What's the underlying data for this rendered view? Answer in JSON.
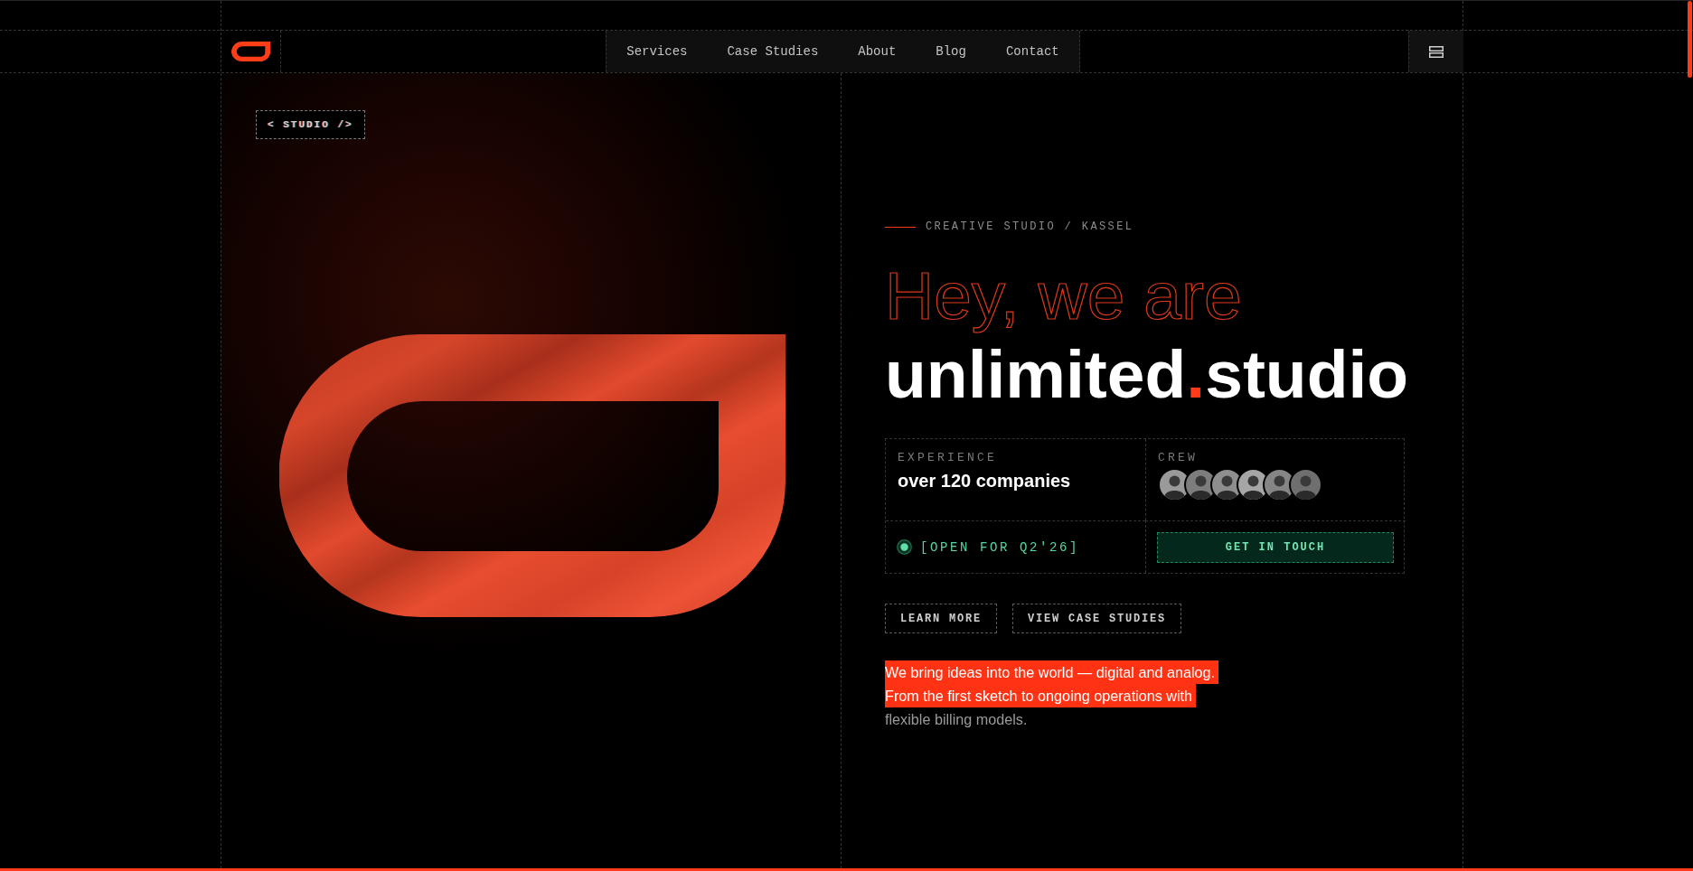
{
  "header": {
    "nav": [
      "Services",
      "Case Studies",
      "About",
      "Blog",
      "Contact"
    ]
  },
  "hero": {
    "tag": "< STUDIO />",
    "kicker": "CREATIVE STUDIO / KASSEL",
    "headline": "Hey, we are",
    "brand": [
      {
        "text": "unlimited",
        "accent": false
      },
      {
        "text": ".",
        "accent": true
      },
      {
        "text": "studio",
        "accent": false
      }
    ]
  },
  "stats": {
    "experience": {
      "label": "EXPERIENCE",
      "value": "over 120 companies"
    },
    "crew": {
      "label": "CREW"
    },
    "availability": "[OPEN FOR Q2'26]",
    "cta": "GET IN TOUCH"
  },
  "buttons": [
    "LEARN MORE",
    "VIEW CASE STUDIES"
  ],
  "intro": [
    {
      "text": "We bring ideas into the world — digital and analog. From the first sketch to ongoing operations with",
      "highlighted": true
    },
    {
      "text": "flexible billing models.",
      "highlighted": false
    }
  ]
}
